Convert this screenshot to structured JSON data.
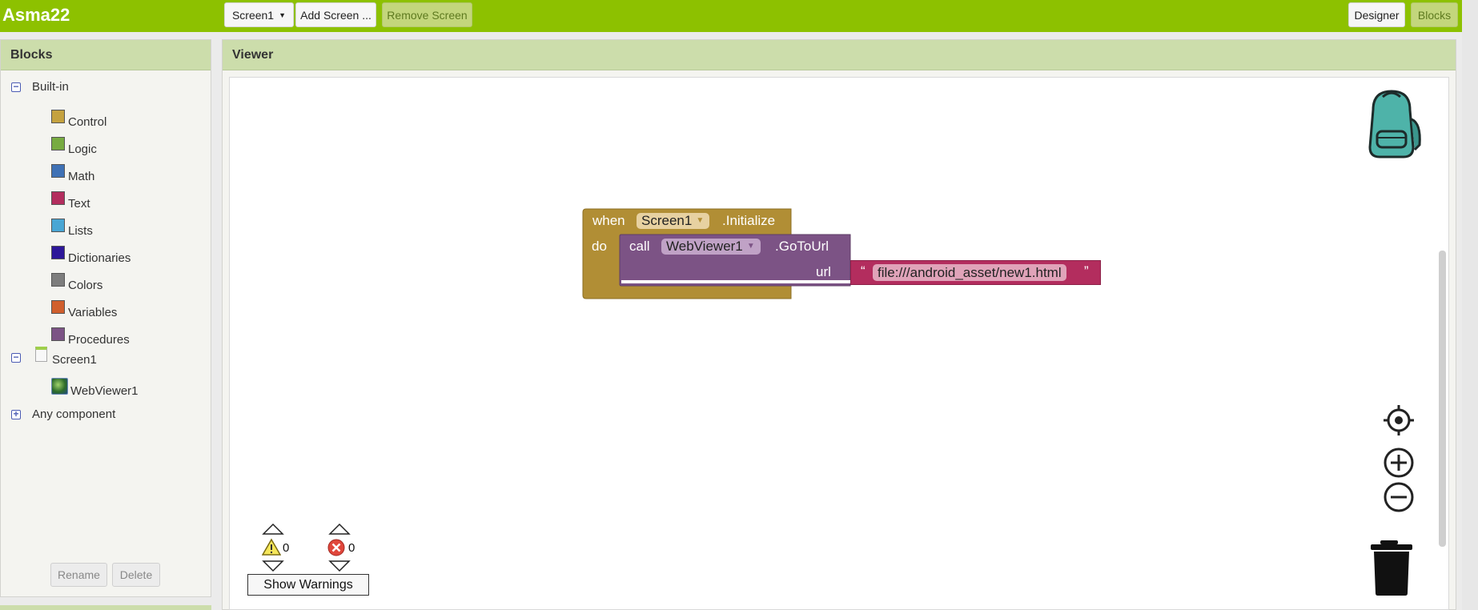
{
  "app": {
    "title": "Asma22"
  },
  "toolbar": {
    "screen_select": "Screen1",
    "add_screen": "Add Screen ...",
    "remove_screen": "Remove Screen",
    "designer": "Designer",
    "blocks": "Blocks"
  },
  "blocks_panel": {
    "header": "Blocks",
    "builtin_label": "Built-in",
    "categories": [
      {
        "label": "Control",
        "color": "#c5a23f"
      },
      {
        "label": "Logic",
        "color": "#77ab41"
      },
      {
        "label": "Math",
        "color": "#3f71b5"
      },
      {
        "label": "Text",
        "color": "#b32d5e"
      },
      {
        "label": "Lists",
        "color": "#49a6d4"
      },
      {
        "label": "Dictionaries",
        "color": "#2d1799"
      },
      {
        "label": "Colors",
        "color": "#7d7d7d"
      },
      {
        "label": "Variables",
        "color": "#d05f2d"
      },
      {
        "label": "Procedures",
        "color": "#7c5385"
      }
    ],
    "screen_label": "Screen1",
    "component_label": "WebViewer1",
    "any_component_label": "Any component",
    "rename": "Rename",
    "delete": "Delete"
  },
  "viewer": {
    "header": "Viewer",
    "event_block": {
      "when": "when",
      "component": "Screen1",
      "event": ".Initialize",
      "do": "do"
    },
    "call_block": {
      "call": "call",
      "component": "WebViewer1",
      "method": ".GoToUrl",
      "param": "url"
    },
    "text_block": {
      "open_quote": "“",
      "value": "file:///android_asset/new1.html",
      "close_quote": "”"
    },
    "warnings_count": "0",
    "errors_count": "0",
    "show_warnings": "Show Warnings"
  },
  "colors": {
    "topbar": "#8dc100",
    "control_block": "#b18e35",
    "component_block": "#7c5385",
    "text_block": "#b32d5e"
  }
}
